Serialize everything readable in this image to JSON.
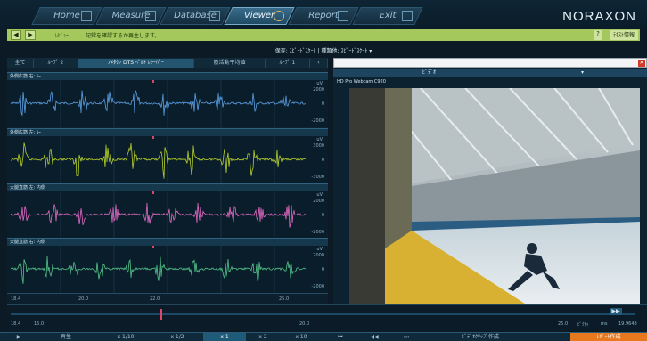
{
  "nav": {
    "tabs": [
      {
        "label": "Home",
        "icon": "home-icon"
      },
      {
        "label": "Measure",
        "icon": "measure-icon"
      },
      {
        "label": "Database",
        "icon": "database-icon"
      },
      {
        "label": "Viewer",
        "icon": "viewer-icon"
      },
      {
        "label": "Report",
        "icon": "report-icon"
      },
      {
        "label": "Exit",
        "icon": "exit-icon"
      }
    ],
    "active": "Viewer",
    "brand": "NORAXON"
  },
  "toolbar": {
    "play_label": "ﾚﾋﾞｭｰ",
    "status": "記録を確認するか再生します。",
    "help": "?",
    "report_label": "ﾃｷｽﾄ情報"
  },
  "record_title": "保存: ｽﾋﾟｰﾄﾞｽｹｰﾄ | 種類他: ｽﾋﾟｰﾄﾞｽｹｰﾄ ▾",
  "left_tabs": [
    "全て",
    "ﾙｰﾌﾟ 2",
    "ﾉﾒﾀｸﾝ DTS ﾍﾞﾙﾄ ﾚｼｰﾊﾞｰ",
    "筋活動平均値",
    "ﾙｰﾌﾟ 1",
    "‹"
  ],
  "channels": [
    {
      "name": "外側広筋 右: ﾙｰ",
      "color": "#5b9fe3",
      "unit": "uV",
      "scale": [
        "2000",
        "0",
        "-2000"
      ]
    },
    {
      "name": "外側広筋 左: ﾙｰ",
      "color": "#b7d12b",
      "unit": "uV",
      "scale": [
        "3000",
        "0",
        "-3000"
      ]
    },
    {
      "name": "大腿直筋 左: 内側",
      "color": "#e06bc4",
      "unit": "uV",
      "scale": [
        "2000",
        "0",
        "-2000"
      ]
    },
    {
      "name": "大腿直筋 右: 内側",
      "color": "#52c48a",
      "unit": "uV",
      "scale": [
        "2000",
        "0",
        "-2000"
      ]
    }
  ],
  "left_axis_ticks": [
    "18.4",
    "20.0",
    "22.0",
    "25.0"
  ],
  "video": {
    "source_label": "ﾋﾞﾃﾞｵ",
    "camera_label": "HD Pro Webcam C920",
    "close": "✕"
  },
  "timeline": {
    "labels": [
      "18.4",
      "15.0",
      "20.0",
      "25.0",
      "ﾋﾟｸﾁｬ",
      "ms",
      "19.9648"
    ]
  },
  "controls": [
    {
      "label": "▶",
      "active": false
    },
    {
      "label": "再生",
      "active": false
    },
    {
      "label": "x 1/10",
      "active": false
    },
    {
      "label": "x 1/2",
      "active": false
    },
    {
      "label": "x 1",
      "active": true
    },
    {
      "label": "x 2",
      "active": false
    },
    {
      "label": "x 10",
      "active": false
    },
    {
      "label": "⏮",
      "active": false
    },
    {
      "label": "◀◀",
      "active": false
    },
    {
      "label": "⏭",
      "active": false
    },
    {
      "label": "ﾋﾞﾃﾞｵｸﾘｯﾌﾟ作成",
      "active": false
    }
  ],
  "controls_report": "ﾚﾎﾟｰﾄ作成",
  "colors": {
    "accent_green": "#a4c85c",
    "orange": "#e8781e"
  }
}
